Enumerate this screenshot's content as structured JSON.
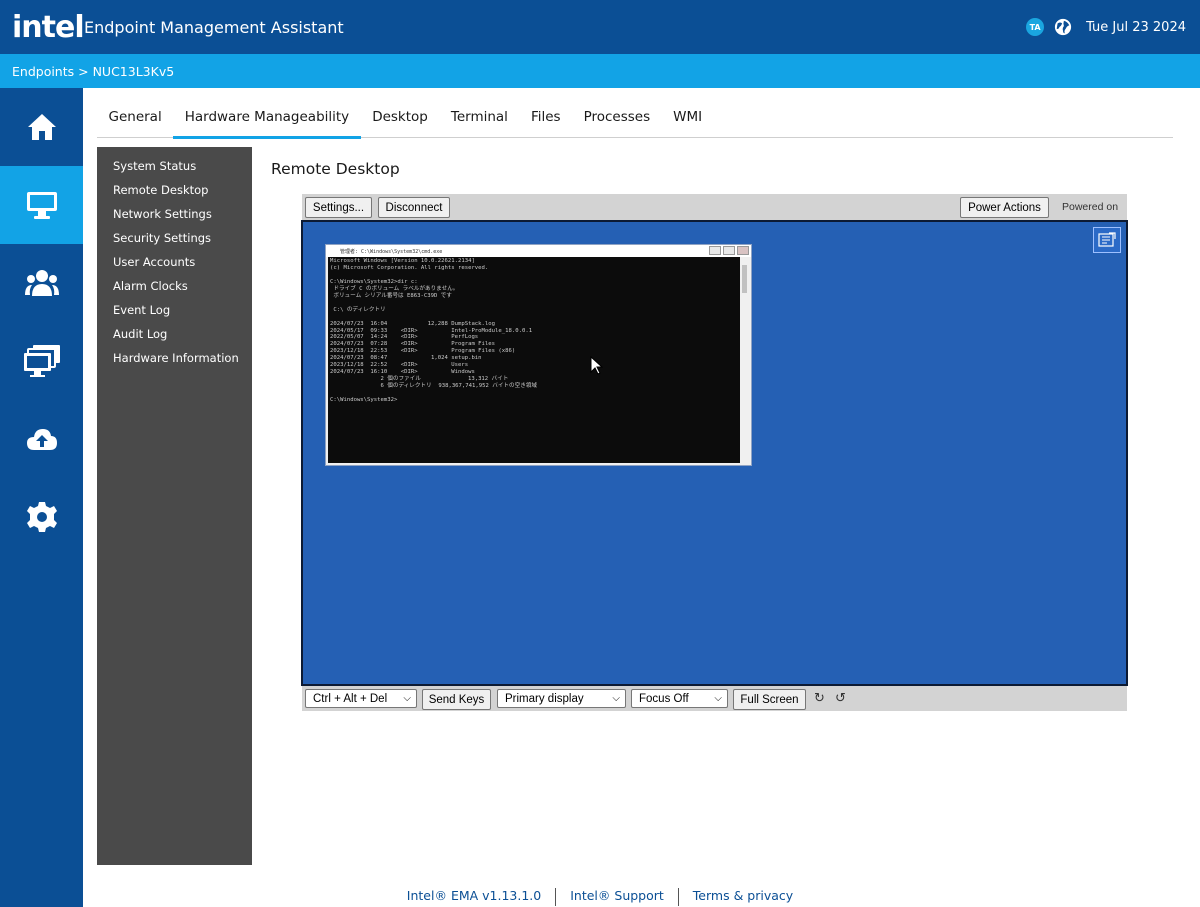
{
  "header": {
    "logo": "intel",
    "title": "Endpoint Management Assistant",
    "user_initials": "TA",
    "date": "Tue Jul 23 2024"
  },
  "breadcrumb": "Endpoints > NUC13L3Kv5",
  "rail": {
    "items": [
      "home-icon",
      "desktop-icon",
      "users-icon",
      "groups-icon",
      "cloud-upload-icon",
      "settings-icon"
    ],
    "active_index": 1
  },
  "tabs": [
    "General",
    "Hardware Manageability",
    "Desktop",
    "Terminal",
    "Files",
    "Processes",
    "WMI"
  ],
  "active_tab": "Hardware Manageability",
  "submenu": [
    "System Status",
    "Remote Desktop",
    "Network Settings",
    "Security Settings",
    "User Accounts",
    "Alarm Clocks",
    "Event Log",
    "Audit Log",
    "Hardware Information"
  ],
  "section_title": "Remote Desktop",
  "toolbar": {
    "settings": "Settings...",
    "disconnect": "Disconnect",
    "power_actions": "Power Actions",
    "power_status": "Powered on"
  },
  "remote_window": {
    "title": "管理者: C:\\Windows\\System32\\cmd.exe",
    "console_text": "Microsoft Windows [Version 10.0.22621.2134]\n(c) Microsoft Corporation. All rights reserved.\n\nC:\\Windows\\System32>dir c:\n ドライブ C のボリューム ラベルがありません。\n ボリューム シリアル番号は E863-C39D です\n\n C:\\ のディレクトリ\n\n2024/07/23  16:04            12,288 DumpStack.log\n2024/05/17  09:33    <DIR>          Intel-ProModule_18.0.0.1\n2022/05/07  14:24    <DIR>          PerfLogs\n2024/07/23  07:28    <DIR>          Program Files\n2023/12/18  22:53    <DIR>          Program Files (x86)\n2024/07/23  08:47             1,024 setup.bin\n2023/12/18  22:52    <DIR>          Users\n2024/07/23  16:10    <DIR>          Windows\n               2 個のファイル              13,312 バイト\n               6 個のディレクトリ  938,367,741,952 バイトの空き領域\n\nC:\\Windows\\System32>"
  },
  "bottom_bar": {
    "keys_select": "Ctrl + Alt + Del",
    "send_keys": "Send Keys",
    "display_select": "Primary display",
    "focus_select": "Focus Off",
    "full_screen": "Full Screen"
  },
  "footer": {
    "version": "Intel® EMA v1.13.1.0",
    "support": "Intel® Support",
    "terms": "Terms & privacy"
  },
  "colors": {
    "brand_dark": "#0b4f95",
    "brand_light": "#12a3e6",
    "desktop_bg": "#2560b4",
    "submenu_bg": "#4a4a4a"
  }
}
